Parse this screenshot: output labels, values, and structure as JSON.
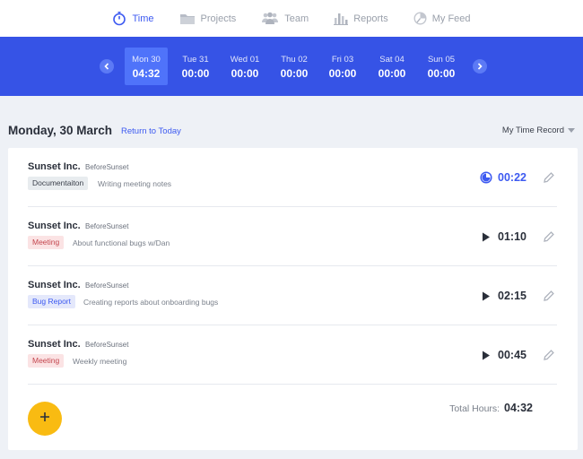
{
  "nav": {
    "items": [
      {
        "label": "Time",
        "icon": "stopwatch-icon",
        "active": true
      },
      {
        "label": "Projects",
        "icon": "folder-icon",
        "active": false
      },
      {
        "label": "Team",
        "icon": "team-icon",
        "active": false
      },
      {
        "label": "Reports",
        "icon": "bar-chart-icon",
        "active": false
      },
      {
        "label": "My Feed",
        "icon": "feed-icon",
        "active": false
      }
    ]
  },
  "week": {
    "days": [
      {
        "name": "Mon 30",
        "time": "04:32",
        "active": true
      },
      {
        "name": "Tue 31",
        "time": "00:00",
        "active": false
      },
      {
        "name": "Wed 01",
        "time": "00:00",
        "active": false
      },
      {
        "name": "Thu 02",
        "time": "00:00",
        "active": false
      },
      {
        "name": "Fri 03",
        "time": "00:00",
        "active": false
      },
      {
        "name": "Sat 04",
        "time": "00:00",
        "active": false
      },
      {
        "name": "Sun 05",
        "time": "00:00",
        "active": false
      }
    ]
  },
  "header": {
    "date": "Monday, 30 March",
    "return_link": "Return to Today",
    "record_select": "My Time Record"
  },
  "entries": [
    {
      "client": "Sunset Inc.",
      "project": "BeforeSunset",
      "tag": "Documentaiton",
      "tag_color": "#e8ecef",
      "description": "Writing meeting notes",
      "duration": "00:22",
      "running": true
    },
    {
      "client": "Sunset Inc.",
      "project": "BeforeSunset",
      "tag": "Meeting",
      "tag_color": "#fbe3e4",
      "description": "About functional bugs w/Dan",
      "duration": "01:10",
      "running": false
    },
    {
      "client": "Sunset Inc.",
      "project": "BeforeSunset",
      "tag": "Bug Report",
      "tag_color": "#e4e8fb",
      "description": "Creating reports about onboarding bugs",
      "duration": "02:15",
      "running": false
    },
    {
      "client": "Sunset Inc.",
      "project": "BeforeSunset",
      "tag": "Meeting",
      "tag_color": "#fbe3e4",
      "description": "Weekly meeting",
      "duration": "00:45",
      "running": false
    }
  ],
  "footer": {
    "add_label": "+",
    "total_label": "Total Hours:",
    "total_value": "04:32"
  },
  "colors": {
    "accent": "#3d5af1",
    "band": "#3653e6",
    "add_button": "#f9bb12"
  }
}
